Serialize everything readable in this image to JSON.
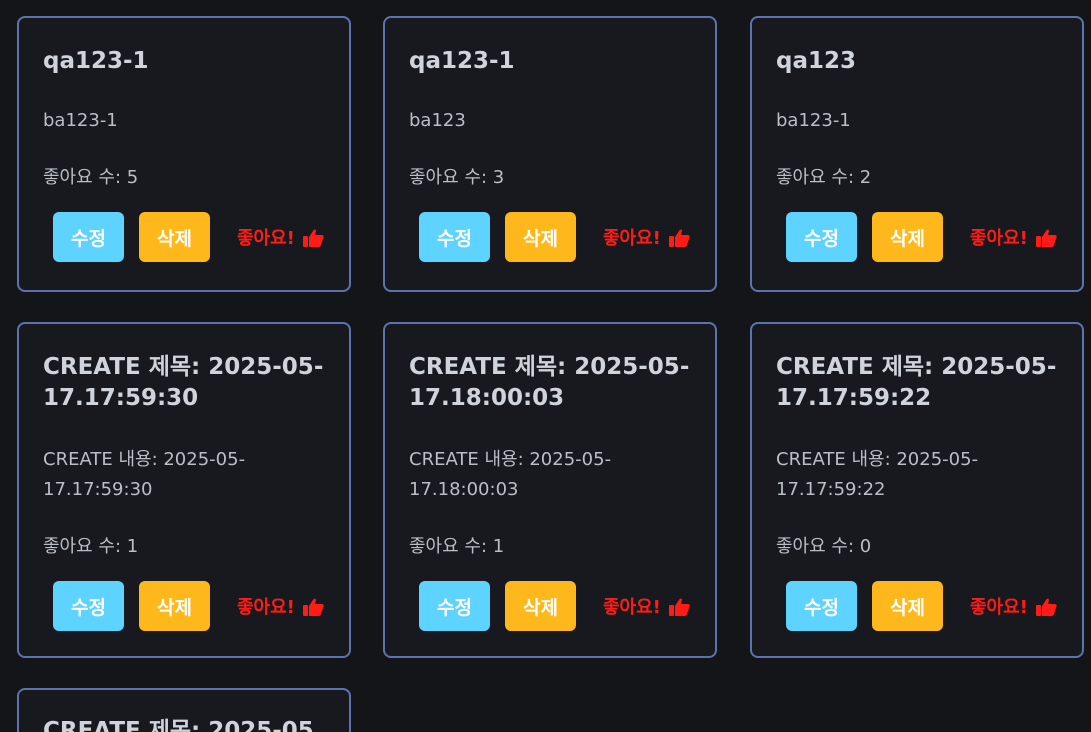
{
  "labels": {
    "edit": "수정",
    "delete": "삭제",
    "like": "좋아요!",
    "likes_prefix": "좋아요 수: "
  },
  "colors": {
    "background": "#141518",
    "card_border": "#5b74ad",
    "edit_button": "#5fd3ff",
    "delete_button": "#ffb81c",
    "like_text": "#ff1c16"
  },
  "icons": {
    "like": "thumbs-up-icon"
  },
  "cards": [
    {
      "title": "qa123-1",
      "content": "ba123-1",
      "likes": "5"
    },
    {
      "title": "qa123-1",
      "content": "ba123",
      "likes": "3"
    },
    {
      "title": "qa123",
      "content": "ba123-1",
      "likes": "2"
    },
    {
      "title": "CREATE 제목: 2025-05-17.17:59:30",
      "content": "CREATE 내용: 2025-05-17.17:59:30",
      "likes": "1"
    },
    {
      "title": "CREATE 제목: 2025-05-17.18:00:03",
      "content": "CREATE 내용: 2025-05-17.18:00:03",
      "likes": "1"
    },
    {
      "title": "CREATE 제목: 2025-05-17.17:59:22",
      "content": "CREATE 내용: 2025-05-17.17:59:22",
      "likes": "0"
    },
    {
      "title": "CREATE 제목: 2025-05"
    }
  ]
}
